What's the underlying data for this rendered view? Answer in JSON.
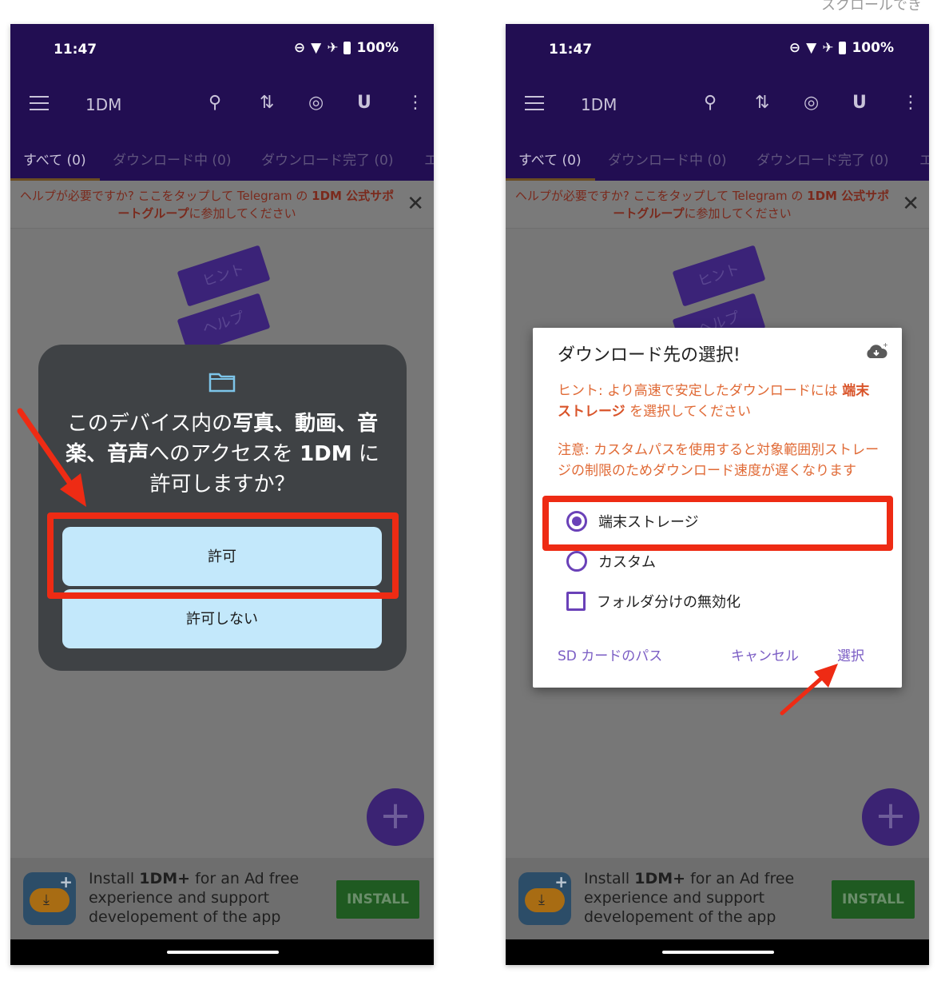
{
  "top_note": "スクロールでき",
  "status": {
    "time": "11:47",
    "battery": "100%"
  },
  "app": {
    "title": "1DM",
    "tabs": [
      "すべて (0)",
      "ダウンロード中 (0)",
      "ダウンロード完了 (0)",
      "エ"
    ],
    "help_text_pre": "ヘルプが必要ですか? ここをタップして Telegram の ",
    "help_text_bold": "1DM 公式サポートグループ",
    "help_text_post": "に参加してください",
    "stickers": [
      "ヒント",
      "ヘルプ"
    ]
  },
  "ad": {
    "pre": "Install ",
    "bold": "1DM+",
    "post": " for an Ad free experience and support developement of the app",
    "install_label": "INSTALL"
  },
  "permission_dialog": {
    "text_pre": "このデバイス内の",
    "text_bold": "写真、動画、音楽、音声",
    "text_mid": "へのアクセスを ",
    "text_app": "1DM",
    "text_post": " に許可しますか？",
    "allow_label": "許可",
    "deny_label": "許可しない"
  },
  "download_dialog": {
    "title": "ダウンロード先の選択!",
    "hint_pre": "ヒント: より高速で安定したダウンロードには ",
    "hint_bold": "端末ストレージ",
    "hint_post": " を選択してください",
    "note": "注意: カスタムパスを使用すると対象範囲別ストレージの制限のためダウンロード速度が遅くなります",
    "options": {
      "device": "端末ストレージ",
      "custom": "カスタム",
      "disable_folders": "フォルダ分けの無効化"
    },
    "selected": "device",
    "sd_label": "SD カードのパス",
    "cancel_label": "キャンセル",
    "select_label": "選択"
  }
}
